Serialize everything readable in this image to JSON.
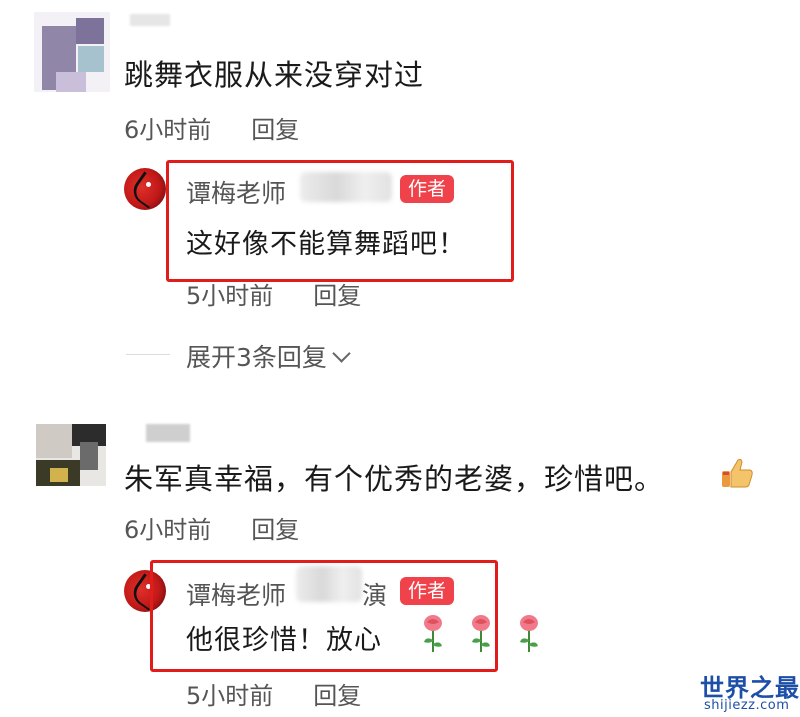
{
  "comments": [
    {
      "text": "跳舞衣服从来没穿对过",
      "time": "6小时前",
      "reply_label": "回复",
      "author_reply": {
        "name": "谭梅老师",
        "name_suffix": "",
        "badge": "作者",
        "text": "这好像不能算舞蹈吧！",
        "time": "5小时前",
        "reply_label": "回复"
      },
      "expand_label": "展开3条回复"
    },
    {
      "text": "朱军真幸福，有个优秀的老婆，珍惜吧。",
      "emoji": "thumbs-up-icon",
      "time": "6小时前",
      "reply_label": "回复",
      "author_reply": {
        "name": "谭梅老师",
        "name_suffix": "演",
        "badge": "作者",
        "text": "他很珍惜！放心",
        "emoji": "rose-icon",
        "time": "5小时前",
        "reply_label": "回复"
      }
    }
  ],
  "watermark": {
    "title": "世界之最",
    "url": "shijiezz.com"
  },
  "colors": {
    "badge": "#f0424a",
    "highlight": "#e21b1b",
    "watermark": "#1d4fa8"
  }
}
